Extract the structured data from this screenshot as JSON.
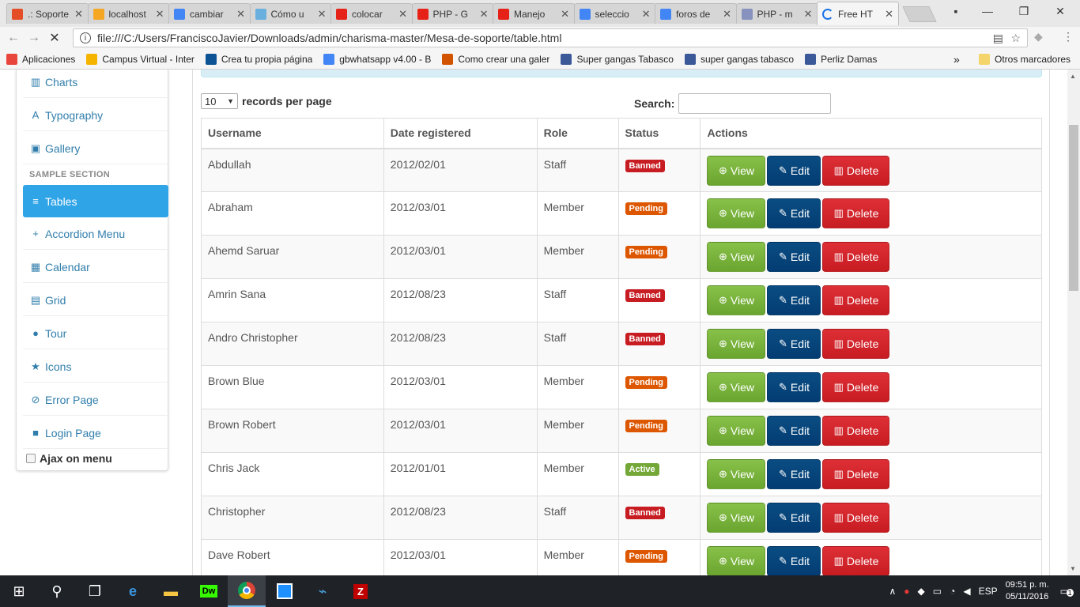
{
  "tabs": [
    {
      "label": ".: Soporte",
      "fav": "#e44d26",
      "icon": "html5-icon"
    },
    {
      "label": "localhost",
      "fav": "#f5a623",
      "icon": "phpmyadmin-icon"
    },
    {
      "label": "cambiar",
      "fav": "#4285f4",
      "icon": "google-icon"
    },
    {
      "label": "Cómo u",
      "fav": "#6ab0de",
      "icon": "page-icon"
    },
    {
      "label": "colocar",
      "fav": "#e62117",
      "icon": "youtube-icon"
    },
    {
      "label": "PHP - G",
      "fav": "#e62117",
      "icon": "youtube-icon"
    },
    {
      "label": "Manejo",
      "fav": "#e62117",
      "icon": "youtube-icon"
    },
    {
      "label": "seleccio",
      "fav": "#4285f4",
      "icon": "google-icon"
    },
    {
      "label": "foros de",
      "fav": "#4285f4",
      "icon": "google-icon"
    },
    {
      "label": "PHP - m",
      "fav": "#8892bf",
      "icon": "php-icon"
    },
    {
      "label": "Free HT",
      "fav": "#1a73e8",
      "icon": "loading-icon"
    }
  ],
  "address": "file:///C:/Users/FranciscoJavier/Downloads/admin/charisma-master/Mesa-de-soporte/table.html",
  "bookmarks": [
    {
      "label": "Aplicaciones",
      "color": "#e8453c",
      "icon": "apps-icon"
    },
    {
      "label": "Campus Virtual - Inter",
      "color": "#f4b400",
      "icon": "campus-icon"
    },
    {
      "label": "Crea tu propia página",
      "color": "#0b5394",
      "icon": "crown-icon"
    },
    {
      "label": "gbwhatsapp v4.00 - B",
      "color": "#4285f4",
      "icon": "google-icon"
    },
    {
      "label": "Como crear una galer",
      "color": "#d35400",
      "icon": "blog-icon"
    },
    {
      "label": "Super gangas Tabasco",
      "color": "#3b5998",
      "icon": "facebook-icon"
    },
    {
      "label": "super gangas tabasco",
      "color": "#3b5998",
      "icon": "facebook-icon"
    },
    {
      "label": "Perliz Damas",
      "color": "#3b5998",
      "icon": "facebook-icon"
    }
  ],
  "bookmarks_more": "»",
  "other_bookmarks": "Otros marcadores",
  "sidebar": {
    "items_top": [
      {
        "label": "Charts",
        "icon": "▥",
        "name": "chart-icon"
      },
      {
        "label": "Typography",
        "icon": "A",
        "name": "font-icon"
      },
      {
        "label": "Gallery",
        "icon": "▣",
        "name": "picture-icon"
      }
    ],
    "section": "SAMPLE SECTION",
    "items": [
      {
        "label": "Tables",
        "icon": "≡",
        "name": "list-icon",
        "active": true
      },
      {
        "label": "Accordion Menu",
        "icon": "+",
        "name": "plus-icon"
      },
      {
        "label": "Calendar",
        "icon": "▦",
        "name": "calendar-icon"
      },
      {
        "label": "Grid",
        "icon": "▤",
        "name": "grid-icon"
      },
      {
        "label": "Tour",
        "icon": "●",
        "name": "globe-icon"
      },
      {
        "label": "Icons",
        "icon": "★",
        "name": "star-icon"
      },
      {
        "label": "Error Page",
        "icon": "⊘",
        "name": "ban-icon"
      },
      {
        "label": "Login Page",
        "icon": "■",
        "name": "lock-icon"
      }
    ],
    "ajax_label": "Ajax on menu"
  },
  "table_controls": {
    "length_value": "10",
    "length_label": "records per page",
    "search_label": "Search:"
  },
  "columns": [
    "Username",
    "Date registered",
    "Role",
    "Status",
    "Actions"
  ],
  "rows": [
    {
      "username": "Abdullah",
      "date": "2012/02/01",
      "role": "Staff",
      "status": "Banned"
    },
    {
      "username": "Abraham",
      "date": "2012/03/01",
      "role": "Member",
      "status": "Pending"
    },
    {
      "username": "Ahemd Saruar",
      "date": "2012/03/01",
      "role": "Member",
      "status": "Pending"
    },
    {
      "username": "Amrin Sana",
      "date": "2012/08/23",
      "role": "Staff",
      "status": "Banned"
    },
    {
      "username": "Andro Christopher",
      "date": "2012/08/23",
      "role": "Staff",
      "status": "Banned"
    },
    {
      "username": "Brown Blue",
      "date": "2012/03/01",
      "role": "Member",
      "status": "Pending"
    },
    {
      "username": "Brown Robert",
      "date": "2012/03/01",
      "role": "Member",
      "status": "Pending"
    },
    {
      "username": "Chris Jack",
      "date": "2012/01/01",
      "role": "Member",
      "status": "Active"
    },
    {
      "username": "Christopher",
      "date": "2012/08/23",
      "role": "Staff",
      "status": "Banned"
    },
    {
      "username": "Dave Robert",
      "date": "2012/03/01",
      "role": "Member",
      "status": "Pending"
    }
  ],
  "actions": {
    "view": "View",
    "edit": "Edit",
    "delete": "Delete"
  },
  "status_colors": {
    "Banned": "#c71c22",
    "Pending": "#dd5600",
    "Active": "#73a839"
  },
  "tray": {
    "lang": "ESP",
    "time": "09:51 p. m.",
    "date": "05/11/2016",
    "notifications": "1"
  }
}
